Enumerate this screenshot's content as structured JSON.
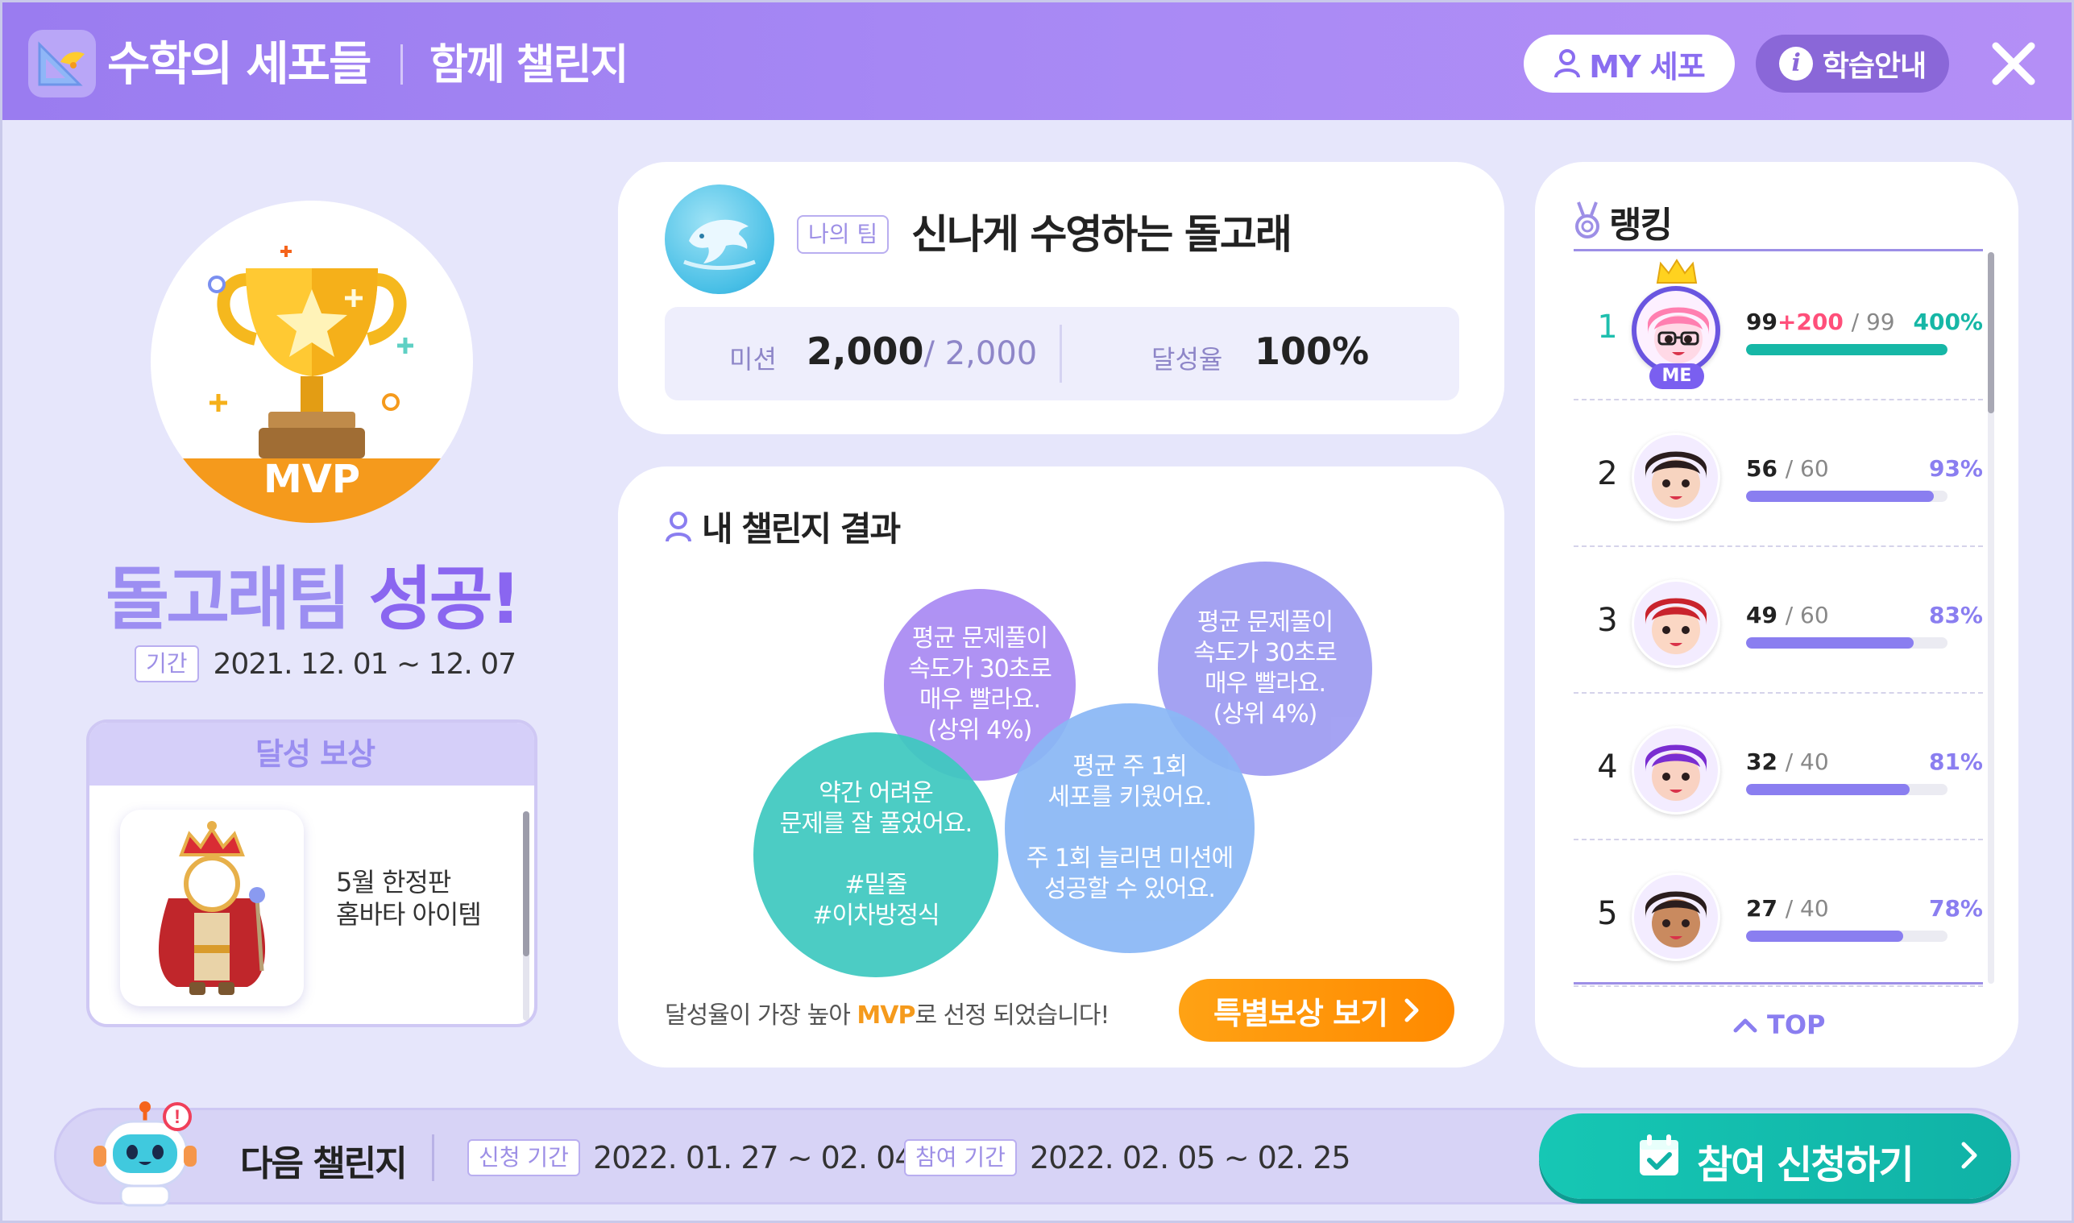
{
  "header": {
    "app_title": "수학의 세포들",
    "page_subtitle": "함께 챌린지",
    "my_button": "MY 세포",
    "guide_button": "학습안내"
  },
  "mvp": {
    "badge": "MVP",
    "team_word": "돌고래팀",
    "success_word": "성공!",
    "period_tag": "기간",
    "period": "2021. 12. 01 ~ 12. 07"
  },
  "reward": {
    "title": "달성 보상",
    "name_line1": "5월 한정판",
    "name_line2": "홈바타 아이템"
  },
  "team": {
    "tag": "나의 팀",
    "name": "신나게 수영하는 돌고래",
    "mission_label": "미션",
    "mission_value": "2,000",
    "mission_total": "/ 2,000",
    "rate_label": "달성율",
    "rate_value": "100%"
  },
  "result": {
    "title": "내 챌린지 결과",
    "bubbles": [
      {
        "text": "평균 문제풀이\n속도가 30초로\n매우 빨라요.\n(상위 4%)",
        "color": "#a98af3"
      },
      {
        "text": "평균 문제풀이\n속도가 30초로\n매우 빨라요.\n(상위 4%)",
        "color": "#9e9cf2"
      },
      {
        "text": "약간 어려운\n문제를 잘 풀었어요.\n\n#밑줄\n#이차방정식",
        "color": "#3fc9c0"
      },
      {
        "text": "평균 주 1회\n세포를 키웠어요.\n\n주 1회 늘리면 미션에\n성공할 수 있어요.",
        "color": "#8ab7f5"
      }
    ],
    "note_before": "달성율이 가장 높아 ",
    "note_mvp": "MVP",
    "note_after": "로 선정 되었습니다!",
    "special_button": "특별보상 보기"
  },
  "ranking": {
    "title": "랭킹",
    "rows": [
      {
        "rank": "1",
        "score": "99",
        "bonus": "+200",
        "total": "/ 99",
        "pct": "400%",
        "fill": 1.0,
        "me": true
      },
      {
        "rank": "2",
        "score": "56",
        "bonus": "",
        "total": "/ 60",
        "pct": "93%",
        "fill": 0.93,
        "me": false
      },
      {
        "rank": "3",
        "score": "49",
        "bonus": "",
        "total": "/ 60",
        "pct": "83%",
        "fill": 0.83,
        "me": false
      },
      {
        "rank": "4",
        "score": "32",
        "bonus": "",
        "total": "/ 40",
        "pct": "81%",
        "fill": 0.81,
        "me": false
      },
      {
        "rank": "5",
        "score": "27",
        "bonus": "",
        "total": "/ 40",
        "pct": "78%",
        "fill": 0.78,
        "me": false
      }
    ],
    "me_badge": "ME",
    "top_button": "TOP"
  },
  "next": {
    "title": "다음 챌린지",
    "apply_tag": "신청 기간",
    "apply_period": "2022. 01. 27 ~ 02. 04",
    "join_tag": "참여 기간",
    "join_period": "2022. 02. 05 ~ 02. 25",
    "apply_button": "참여 신청하기"
  },
  "colors": {
    "header": "#9a7cf0",
    "accent_purple": "#8a66f0",
    "accent_orange": "#f59a1c",
    "accent_teal": "#16b7a6",
    "background": "#e6e6fb"
  }
}
